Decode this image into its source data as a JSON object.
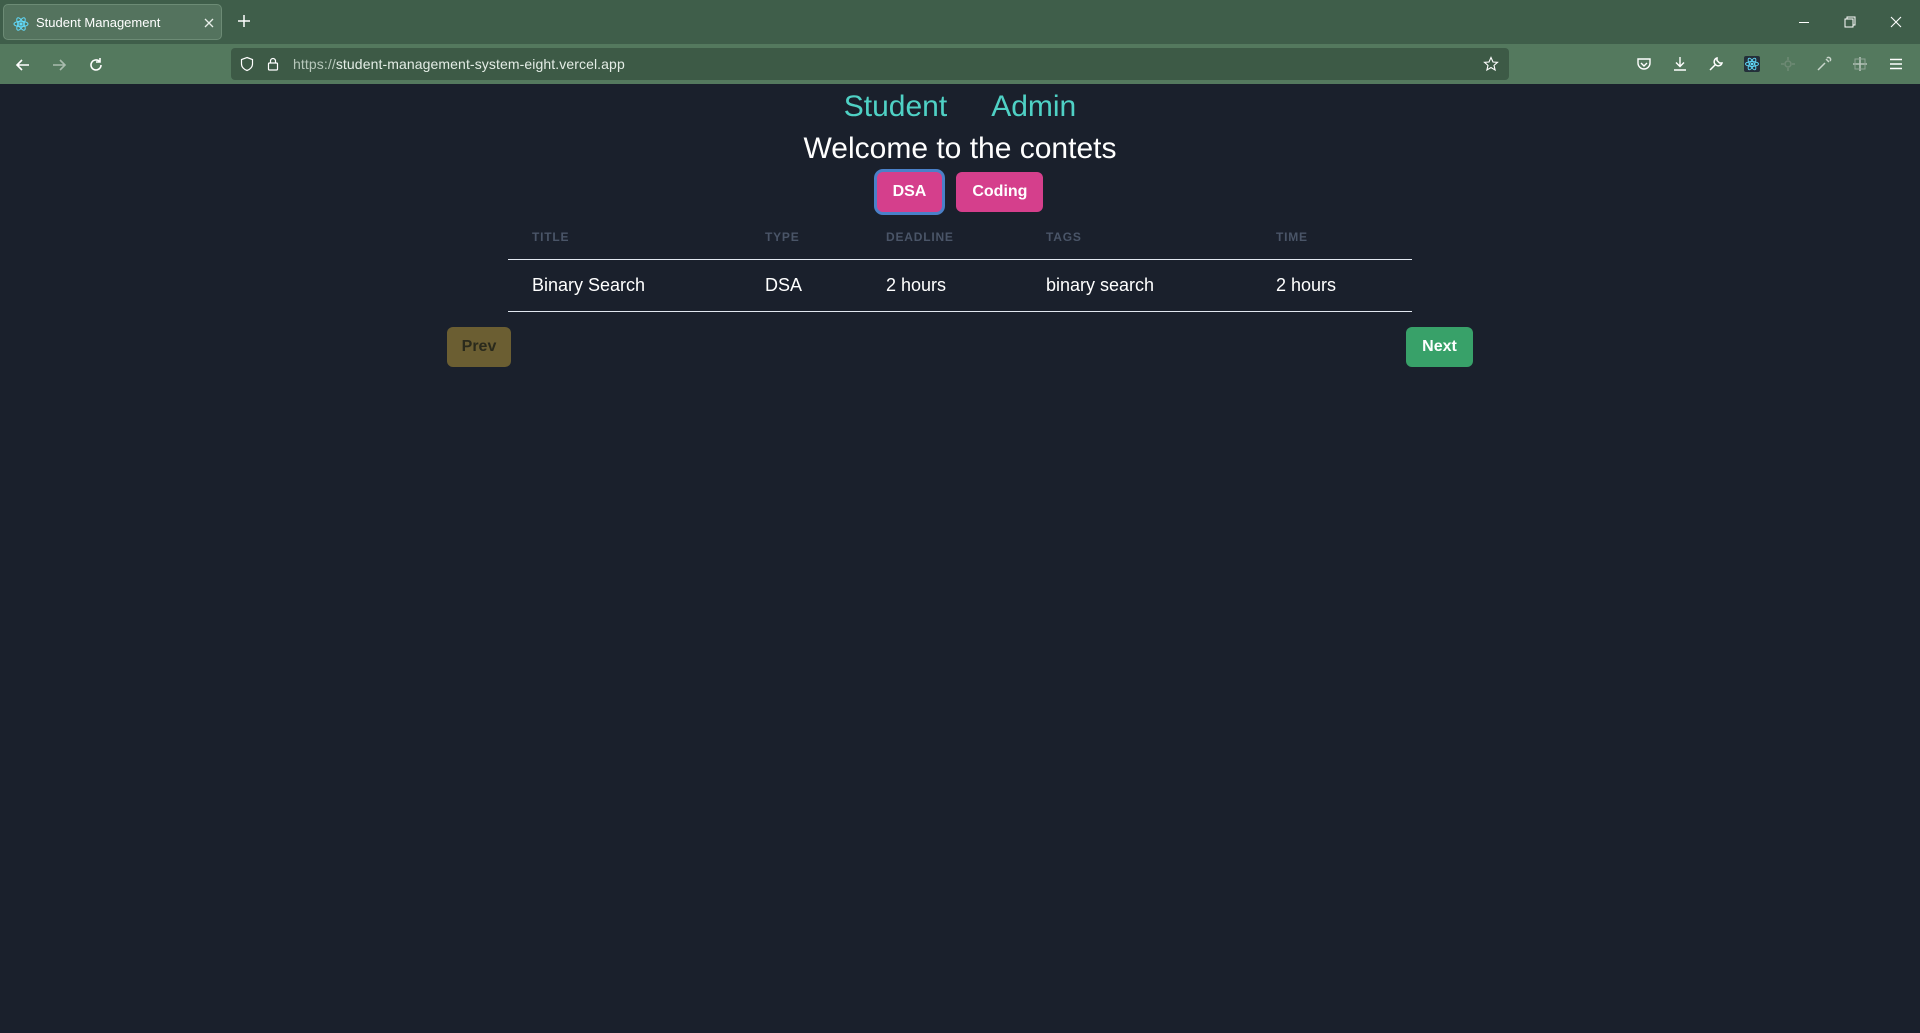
{
  "browser": {
    "tab_title": "Student Management",
    "url_protocol": "https://",
    "url_host": "student-management-system-eight.vercel.app"
  },
  "page": {
    "nav": {
      "student": "Student",
      "admin": "Admin"
    },
    "heading": "Welcome to the contets",
    "type_buttons": {
      "dsa": "DSA",
      "coding": "Coding"
    },
    "table": {
      "headers": [
        "Title",
        "Type",
        "Deadline",
        "Tags",
        "Time"
      ],
      "rows": [
        [
          "Binary Search",
          "DSA",
          "2 hours",
          "binary search",
          "2 hours"
        ]
      ]
    },
    "pagination": {
      "prev": "Prev",
      "next": "Next"
    }
  },
  "colors": {
    "background": "#1a202c",
    "link": "#4fd1c5",
    "pink_button": "#d53f8c",
    "next_button": "#38a169",
    "prev_button": "#6b5e32",
    "browser_chrome": "#3f5e4a"
  }
}
